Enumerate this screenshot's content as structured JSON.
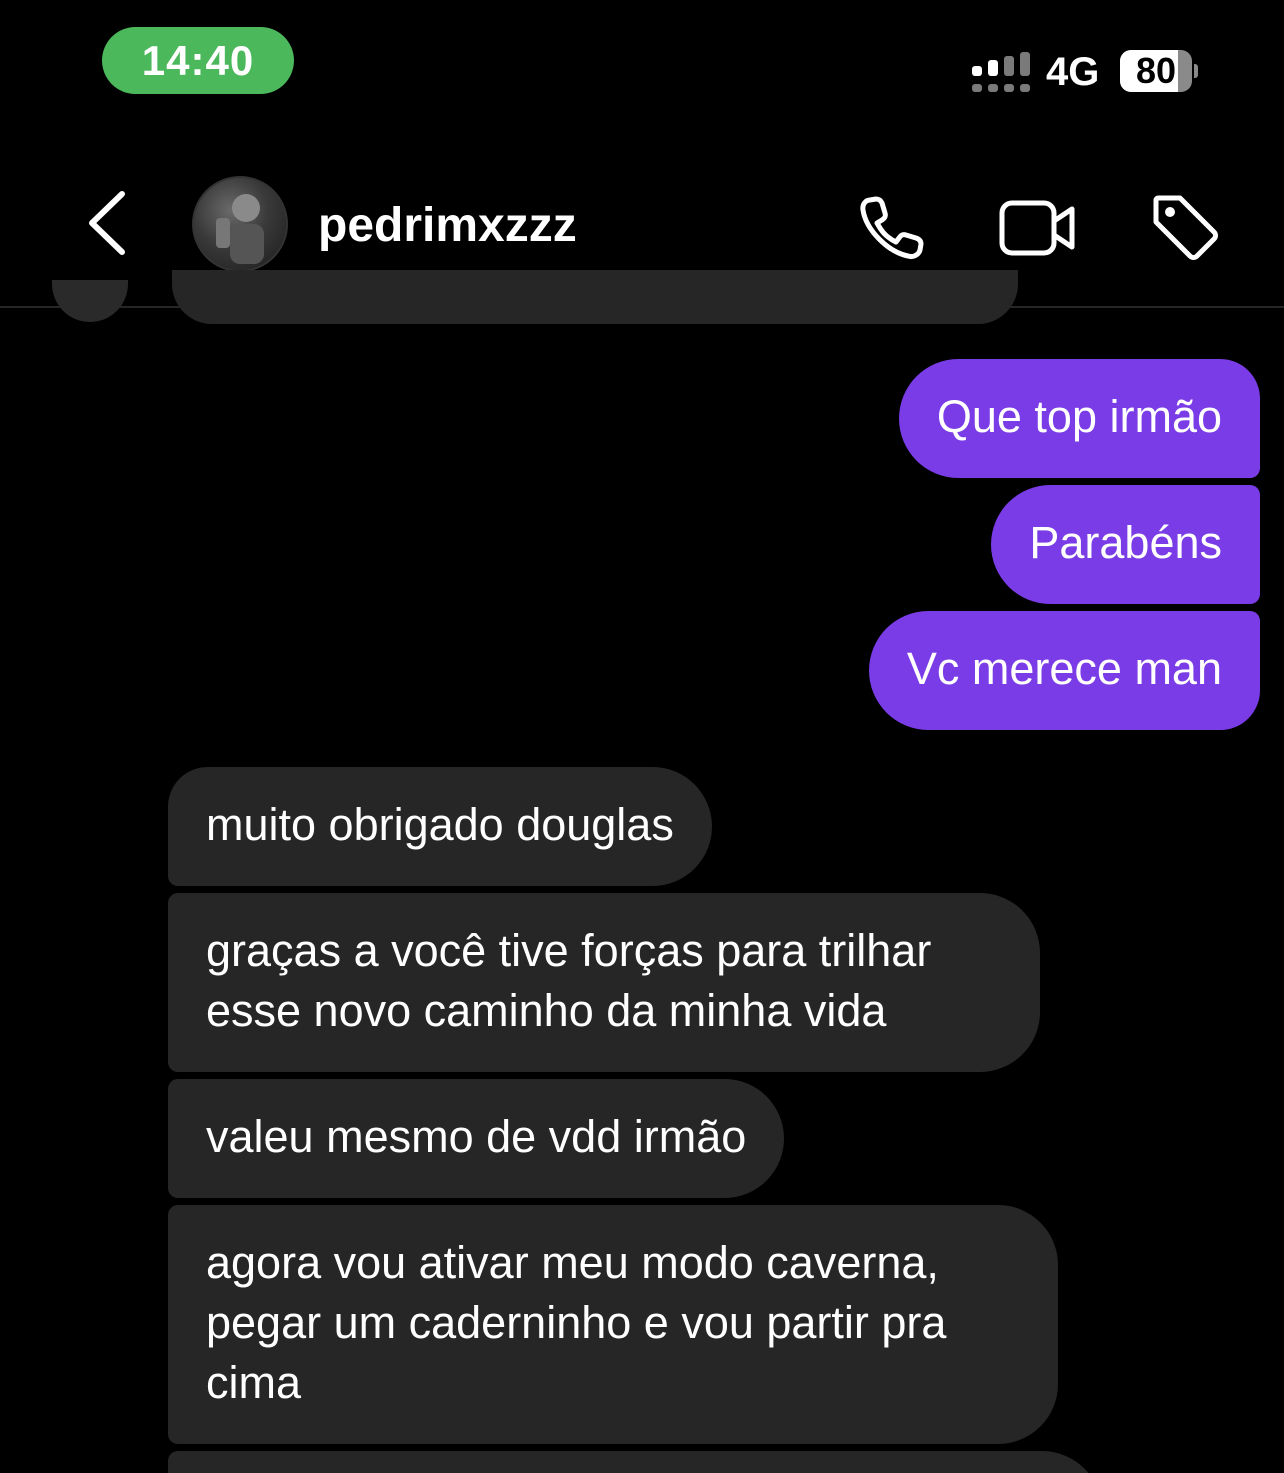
{
  "status_bar": {
    "time": "14:40",
    "network": "4G",
    "battery_level": "80",
    "battery_fraction": 0.8,
    "signal_bars_active": 2,
    "signal_bars_total": 4
  },
  "header": {
    "username": "pedrimxzzz",
    "icons": [
      "back-icon",
      "call-icon",
      "video-call-icon",
      "tag-icon"
    ]
  },
  "colors": {
    "sent_bubble": "#7a3ce6",
    "received_bubble": "#262626",
    "time_pill": "#4cb85c",
    "background": "#000000"
  },
  "messages": {
    "sent": [
      "Que top irmão",
      "Parabéns",
      "Vc merece man"
    ],
    "received": [
      "muito obrigado douglas",
      "graças a você tive forças para trilhar esse novo caminho da minha vida",
      "valeu mesmo de vdd irmão",
      "agora vou ativar meu modo caverna, pegar um caderninho e vou partir pra cima"
    ]
  }
}
